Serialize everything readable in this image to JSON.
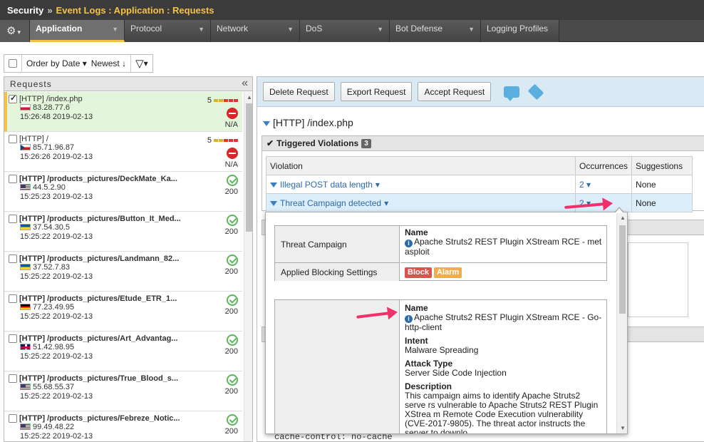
{
  "breadcrumb": {
    "root": "Security",
    "separator": "»",
    "current": "Event Logs : Application : Requests"
  },
  "tabs": [
    {
      "label": "Application",
      "active": true
    },
    {
      "label": "Protocol"
    },
    {
      "label": "Network"
    },
    {
      "label": "DoS"
    },
    {
      "label": "Bot Defense"
    },
    {
      "label": "Logging Profiles"
    }
  ],
  "toolbar": {
    "order_label": "Order by Date",
    "newest_label": "Newest"
  },
  "left_panel": {
    "title": "Requests",
    "items": [
      {
        "path": "[HTTP] /index.php",
        "ip": "83.28.77.6",
        "time": "15:26:48 2019-02-13",
        "score": "5",
        "code": "N/A",
        "flag": "pl",
        "status": "block"
      },
      {
        "path": "[HTTP] /",
        "ip": "85.71.96.87",
        "time": "15:26:26 2019-02-13",
        "score": "5",
        "code": "N/A",
        "flag": "cz",
        "status": "block"
      },
      {
        "path": "[HTTP] /products_pictures/DeckMate_Ka...",
        "ip": "44.5.2.90",
        "time": "15:25:23 2019-02-13",
        "code": "200",
        "flag": "us",
        "status": "ok"
      },
      {
        "path": "[HTTP] /products_pictures/Button_It_Med...",
        "ip": "37.54.30.5",
        "time": "15:25:22 2019-02-13",
        "code": "200",
        "flag": "ua",
        "status": "ok"
      },
      {
        "path": "[HTTP] /products_pictures/Landmann_82...",
        "ip": "37.52.7.83",
        "time": "15:25:22 2019-02-13",
        "code": "200",
        "flag": "ua",
        "status": "ok"
      },
      {
        "path": "[HTTP] /products_pictures/Etude_ETR_1...",
        "ip": "77.23.49.95",
        "time": "15:25:22 2019-02-13",
        "code": "200",
        "flag": "de",
        "status": "ok"
      },
      {
        "path": "[HTTP] /products_pictures/Art_Advantag...",
        "ip": "51.42.98.95",
        "time": "15:25:22 2019-02-13",
        "code": "200",
        "flag": "gb",
        "status": "ok"
      },
      {
        "path": "[HTTP] /products_pictures/True_Blood_s...",
        "ip": "55.68.55.37",
        "time": "15:25:22 2019-02-13",
        "code": "200",
        "flag": "us",
        "status": "ok"
      },
      {
        "path": "[HTTP] /products_pictures/Febreze_Notic...",
        "ip": "99.49.48.22",
        "time": "15:25:22 2019-02-13",
        "code": "200",
        "flag": "us",
        "status": "ok"
      }
    ]
  },
  "actions": {
    "delete": "Delete Request",
    "export": "Export Request",
    "accept": "Accept Request"
  },
  "request_title": "[HTTP] /index.php",
  "violations": {
    "title": "Triggered Violations",
    "count": "3",
    "headers": {
      "violation": "Violation",
      "occurrences": "Occurrences",
      "suggestions": "Suggestions"
    },
    "rows": [
      {
        "name": "Illegal POST data length",
        "occ": "2",
        "sugg": "None"
      },
      {
        "name": "Threat Campaign detected",
        "occ": "2",
        "sugg": "None"
      }
    ]
  },
  "popup": {
    "tc_label": "Threat Campaign",
    "name_label": "Name",
    "tc_name": "Apache Struts2 REST Plugin XStream RCE - met asploit",
    "abs_label": "Applied Blocking Settings",
    "block": "Block",
    "alarm": "Alarm",
    "d_name": "Apache Struts2 REST Plugin XStream RCE - Go-http-client",
    "intent_label": "Intent",
    "intent": "Malware Spreading",
    "attack_label": "Attack Type",
    "attack": "Server Side Code Injection",
    "desc_label": "Description",
    "desc": "This campaign aims to identify Apache Struts2 serve rs vulnerable to Apache Struts2 REST Plugin XStrea m Remote Code Execution vulnerability (CVE-2017-9805). The threat actor instructs the server to downlo"
  },
  "cache_line": "cache-control: no-cache",
  "colors": {
    "accent": "#f6c244",
    "link": "#2d6aa8",
    "arrow": "#f0306a",
    "selected_row": "#e3f5db"
  }
}
